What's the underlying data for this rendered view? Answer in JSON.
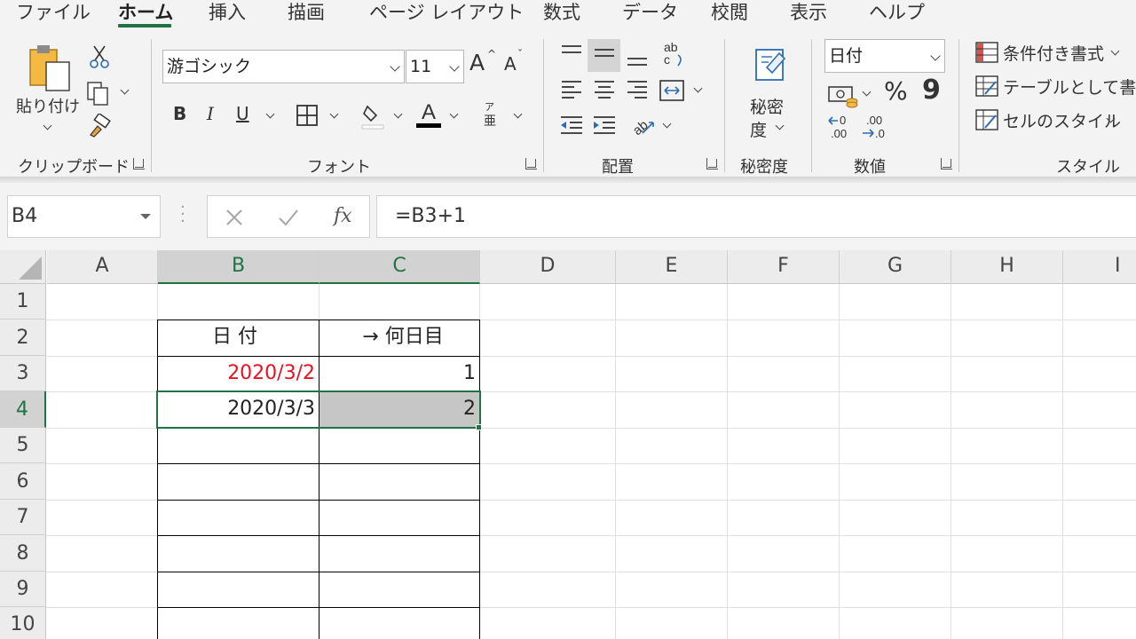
{
  "tabs": [
    "ファイル",
    "ホーム",
    "挿入",
    "描画",
    "ページ レイアウト",
    "数式",
    "データ",
    "校閲",
    "表示",
    "ヘルプ"
  ],
  "active_tab": "ホーム",
  "clipboard": {
    "paste_label": "貼り付け",
    "group_label": "クリップボード"
  },
  "font": {
    "name": "游ゴシック",
    "size": "11",
    "bold": "B",
    "italic": "I",
    "underline": "U",
    "grow": "A",
    "shrink": "A",
    "phonetic_top": "ア",
    "phonetic_bottom": "亜",
    "group_label": "フォント"
  },
  "alignment": {
    "group_label": "配置"
  },
  "sensitivity": {
    "label_line1": "秘密",
    "label_line2": "度",
    "group_label": "秘密度"
  },
  "number": {
    "format": "日付",
    "percent": "%",
    "comma": "9",
    "group_label": "数値"
  },
  "styles": {
    "conditional": "条件付き書式",
    "as_table": "テーブルとして書式",
    "cell_styles": "セルのスタイル",
    "group_label": "スタイル"
  },
  "formula_bar": {
    "name_box": "B4",
    "fx": "fx",
    "formula": "=B3+1"
  },
  "columns": [
    "A",
    "B",
    "C",
    "D",
    "E",
    "F",
    "G",
    "H",
    "I"
  ],
  "rows": [
    "1",
    "2",
    "3",
    "4",
    "5",
    "6",
    "7",
    "8",
    "9",
    "10"
  ],
  "cells": {
    "B2": "日 付",
    "C2": "→ 何日目",
    "B3": "2020/3/2",
    "C3": "1",
    "B4": "2020/3/3",
    "C4": "2"
  },
  "colors": {
    "accent": "#217346",
    "red_text": "#e81123",
    "selection_fill": "#c6c6c6"
  }
}
